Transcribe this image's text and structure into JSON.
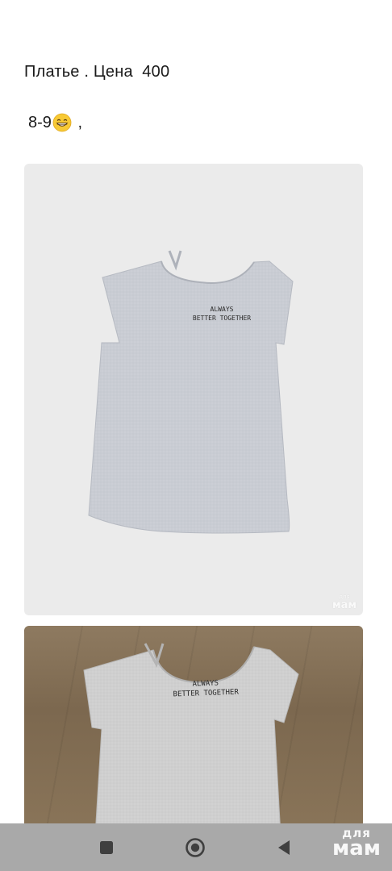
{
  "post": {
    "title": "Платье . Цена  400",
    "size_prefix": "8-9",
    "size_suffix": " ,",
    "emoji_icon": "grinning-face-emoji"
  },
  "photos": [
    {
      "print_line1": "ALWAYS",
      "print_line2": "BETTER TOGETHER",
      "watermark_small": "для",
      "watermark_big": "мам",
      "background": "#ebebeb",
      "garment_color": "#c9ccd3"
    },
    {
      "print_line1": "ALWAYS",
      "print_line2": "BETTER TOGETHER",
      "background": "#86725a",
      "garment_color": "#cfcfcf"
    }
  ],
  "system_nav": {
    "recent_icon": "square-recents-icon",
    "home_icon": "circle-home-icon",
    "back_icon": "triangle-back-icon",
    "bar_color": "#a9a9a9"
  },
  "overlay_watermark": {
    "small": "для",
    "big": "мам"
  }
}
